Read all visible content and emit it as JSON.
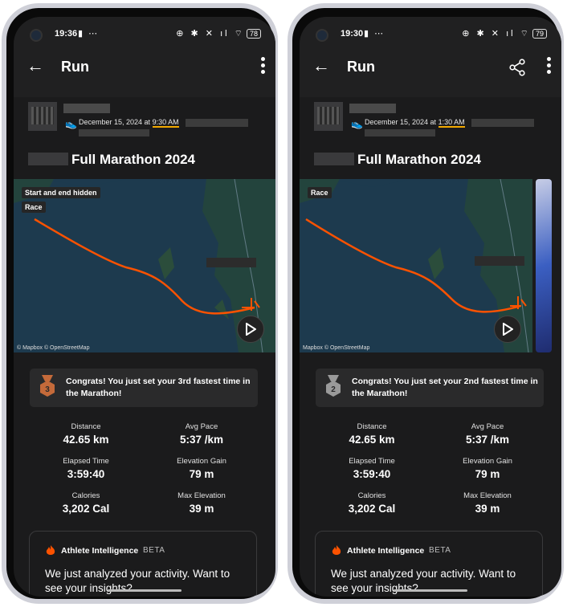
{
  "phones": [
    {
      "status": {
        "time": "19:36",
        "left_icons": "▮ ⋯",
        "right_icons": "⊕ ✱ ✕ ıl ⌔",
        "battery": "78"
      },
      "appbar": {
        "title": "Run"
      },
      "activity": {
        "date_prefix": "December 15, 2024 at ",
        "start_time": "9:30 AM",
        "title": "Full Marathon 2024"
      },
      "map": {
        "tag_hidden": "Start and end hidden",
        "tag_race": "Race",
        "attribution": "© Mapbox © OpenStreetMap"
      },
      "congrats": {
        "text": "Congrats! You just set your 3rd fastest time in the Marathon!",
        "medal_rank": "3"
      },
      "stats": {
        "distance_label": "Distance",
        "distance": "42.65 km",
        "pace_label": "Avg Pace",
        "pace": "5:37 /km",
        "elapsed_label": "Elapsed Time",
        "elapsed": "3:59:40",
        "elev_gain_label": "Elevation Gain",
        "elev_gain": "79 m",
        "calories_label": "Calories",
        "calories": "3,202 Cal",
        "max_elev_label": "Max Elevation",
        "max_elev": "39 m"
      },
      "ai": {
        "title": "Athlete Intelligence",
        "beta": "BETA",
        "body": "We just analyzed your activity. Want to see your insights?"
      }
    },
    {
      "status": {
        "time": "19:30",
        "left_icons": "▮ ⋯",
        "right_icons": "⊕ ✱ ✕ ıl ⌔",
        "battery": "79"
      },
      "appbar": {
        "title": "Run"
      },
      "activity": {
        "date_prefix": "December 15, 2024 at ",
        "start_time": "1:30 AM",
        "title": "Full Marathon 2024"
      },
      "map": {
        "tag_race": "Race",
        "attribution": "Mapbox © OpenStreetMap"
      },
      "congrats": {
        "text": "Congrats! You just set your 2nd fastest time in the Marathon!",
        "medal_rank": "2"
      },
      "stats": {
        "distance_label": "Distance",
        "distance": "42.65 km",
        "pace_label": "Avg Pace",
        "pace": "5:37 /km",
        "elapsed_label": "Elapsed Time",
        "elapsed": "3:59:40",
        "elev_gain_label": "Elevation Gain",
        "elev_gain": "79 m",
        "calories_label": "Calories",
        "calories": "3,202 Cal",
        "max_elev_label": "Max Elevation",
        "max_elev": "39 m"
      },
      "ai": {
        "title": "Athlete Intelligence",
        "beta": "BETA",
        "body": "We just analyzed your activity. Want to see your insights?"
      }
    }
  ],
  "colors": {
    "route": "#fc5200",
    "accent_underline": "#f2a900",
    "bronze": "#c46a3a",
    "silver": "#9a9a9a",
    "map_water": "#1d3a4e"
  },
  "icons": [
    "back-arrow-icon",
    "share-icon",
    "more-vertical-icon",
    "shoe-icon",
    "medal-icon",
    "play-icon",
    "flame-icon"
  ]
}
